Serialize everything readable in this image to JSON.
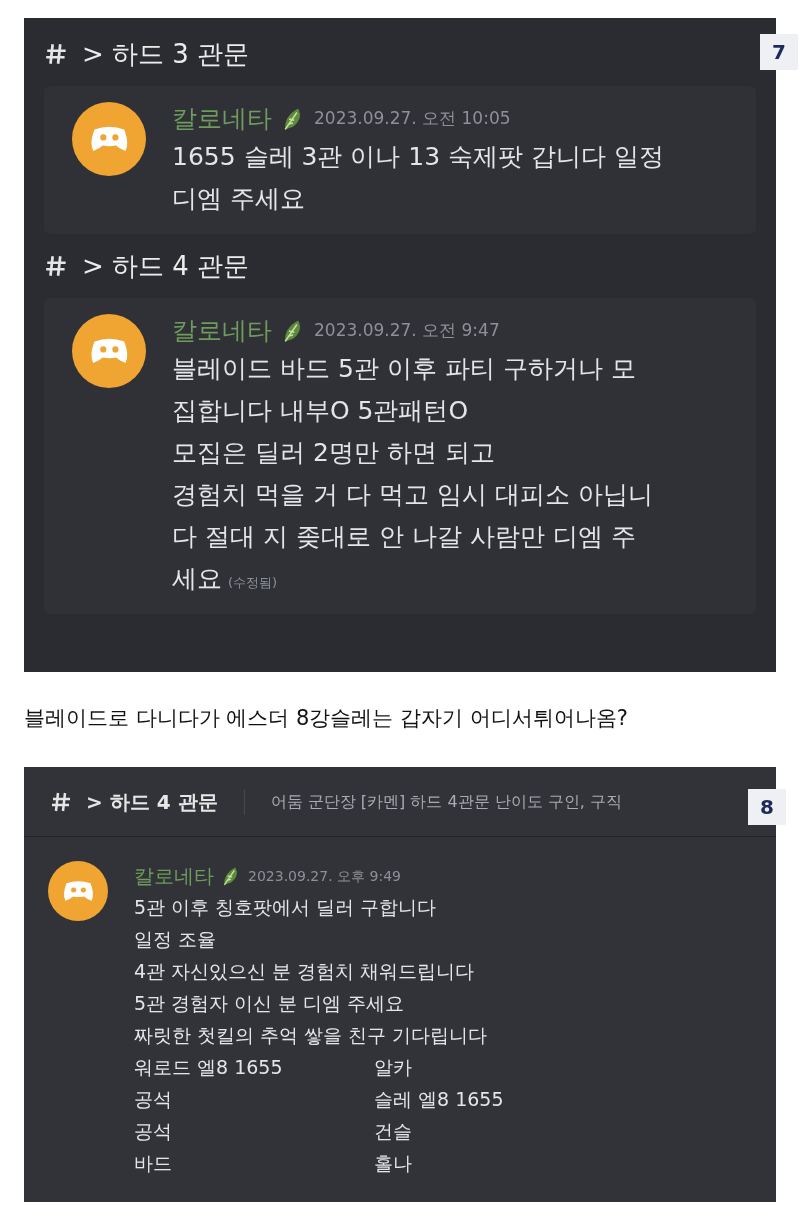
{
  "screenshot_1": {
    "badge": "7",
    "sections": [
      {
        "channel": {
          "prefix": ">",
          "title": "하드 3 관문"
        },
        "message": {
          "author": "칼로네타",
          "timestamp": "2023.09.27. 오전 10:05",
          "lines": [
            "1655 슬레 3관 이나 13 숙제팟 갑니다 일정",
            "디엠 주세요"
          ]
        }
      },
      {
        "channel": {
          "prefix": ">",
          "title": "하드 4 관문"
        },
        "message": {
          "author": "칼로네타",
          "timestamp": "2023.09.27. 오전 9:47",
          "lines": [
            "블레이드 바드 5관 이후 파티 구하거나 모",
            "집합니다 내부O 5관패턴O",
            "모집은 딜러 2명만 하면 되고",
            "경험치 먹을 거 다 먹고 임시 대피소 아닙니",
            "다 절대 지 좆대로 안 나갈 사람만 디엠 주",
            "세요"
          ],
          "edited": "(수정됨)"
        }
      }
    ]
  },
  "caption": "블레이드로 다니다가 에스더 8강슬레는 갑자기 어디서튀어나옴?",
  "screenshot_2": {
    "badge": "8",
    "channel": {
      "prefix": ">",
      "title": "하드 4 관문",
      "topic": "어둠 군단장 [카멘] 하드 4관문 난이도 구인, 구직"
    },
    "message": {
      "author": "칼로네타",
      "timestamp": "2023.09.27. 오후 9:49",
      "lines": [
        "5관 이후 칭호팟에서 딜러 구합니다",
        "일정 조율",
        "4관 자신있으신 분 경험치 채워드립니다",
        "5관 경험자 이신 분 디엠 주세요",
        "짜릿한 첫킬의 추억 쌓을 친구 기다립니다"
      ],
      "roster": [
        [
          "워로드 엘8 1655",
          "알카"
        ],
        [
          "공석",
          "슬레 엘8 1655"
        ],
        [
          "공석",
          "건슬"
        ],
        [
          "바드",
          "홀나"
        ]
      ]
    }
  }
}
